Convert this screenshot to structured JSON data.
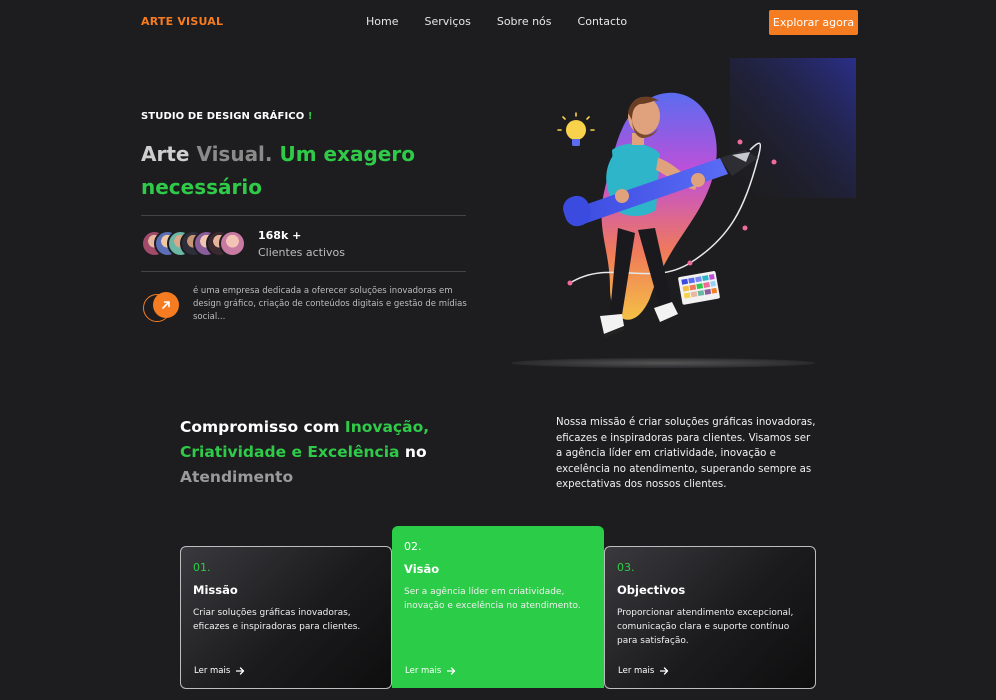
{
  "nav": {
    "brand": "ARTE VISUAL",
    "links": [
      "Home",
      "Serviços",
      "Sobre nós",
      "Contacto"
    ],
    "cta": "Explorar agora"
  },
  "hero": {
    "eyebrow": "STUDIO DE DESIGN GRÁFICO",
    "eyebrow_mark": "!",
    "title_part1": "Arte ",
    "title_part2": "Visual.",
    "title_part3": "Um exagero necessário",
    "stat_number": "168k +",
    "stat_label": "Clientes activos",
    "about": "é uma empresa dedicada a oferecer soluções inovadoras em design gráfico, criação de conteúdos digitais e gestão de mídias social..."
  },
  "commitment": {
    "title_a": "Compromisso com ",
    "title_b": "Inovação, Criatividade e Excelência",
    "title_c": " no ",
    "title_d": "Atendimento",
    "text": "Nossa missão é criar soluções gráficas inovadoras, eficazes e inspiradoras para clientes. Visamos ser a agência líder em criatividade, inovação e excelência no atendimento, superando sempre as expectativas dos nossos clientes."
  },
  "cards": [
    {
      "num": "01.",
      "title": "Missão",
      "desc": "Criar soluções gráficas inovadoras, eficazes e inspiradoras para clientes.",
      "more": "Ler mais"
    },
    {
      "num": "02.",
      "title": "Visão",
      "desc": "Ser a agência líder em criatividade, inovação e excelência no atendimento.",
      "more": "Ler mais"
    },
    {
      "num": "03.",
      "title": "Objectivos",
      "desc": "Proporcionar atendimento excepcional, comunicação clara e suporte contínuo para satisfação.",
      "more": "Ler mais"
    }
  ],
  "colors": {
    "accent_orange": "#f57c20",
    "accent_green": "#2fcb48",
    "background": "#1d1d20"
  }
}
